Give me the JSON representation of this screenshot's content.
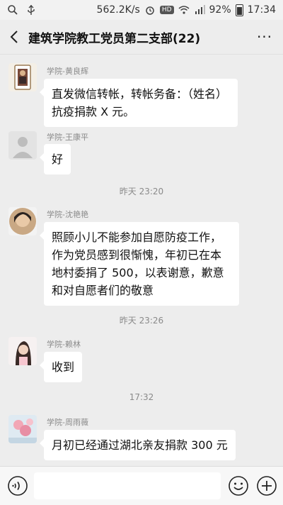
{
  "status_bar": {
    "speed": "562.2K/s",
    "hd": "HD",
    "battery": "92%",
    "time": "17:34"
  },
  "header": {
    "title": "建筑学院教工党员第二支部(22)",
    "more": "···"
  },
  "messages": [
    {
      "sender": "学院-黄良辉",
      "text": "直发微信转帐，转帐务备：（姓名）抗疫捐款 X 元。"
    },
    {
      "sender": "学院-王康平",
      "text": "好"
    },
    {
      "sender": "学院-沈艳艳",
      "text": "照顾小儿不能参加自愿防疫工作，作为党员感到很惭愧，年初已在本地村委捐了 500，以表谢意，歉意和对自愿者们的敬意"
    },
    {
      "sender": "学院-赖林",
      "text": "收到"
    },
    {
      "sender": "学院-周雨薇",
      "text": "月初已经通过湖北亲友捐款 300 元"
    }
  ],
  "timestamps": [
    "昨天 23:20",
    "昨天 23:26",
    "17:32"
  ],
  "colors": {
    "background": "#ededed",
    "bubble": "#ffffff",
    "muted_text": "#8a8a8a"
  },
  "icons": {
    "back": "chevron-left-icon",
    "voice": "voice-icon",
    "emoji": "emoji-icon",
    "plus": "plus-icon"
  }
}
